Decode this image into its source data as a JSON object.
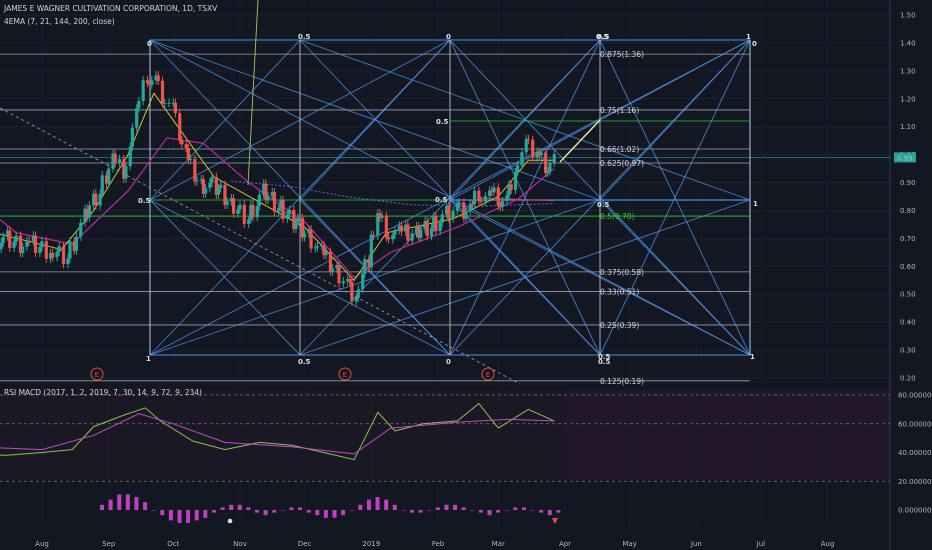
{
  "header": {
    "title": "JAMES E WAGNER CULTIVATION CORPORATION, 1D, TSXV",
    "indicator": "4EMA (7, 21, 144, 200, close)",
    "sub_indicator": "RSI MACD (2017, 1, 2, 2019, 7, 30, 14, 9, 72, 9, 234)"
  },
  "colors": {
    "background": "#131722",
    "up": "#26a69a",
    "down": "#ef5350",
    "ema_fast": "#c8c830",
    "ema_mid": "#b0299b",
    "gann": "#4a90e2",
    "fib": "#d1d4dc",
    "fib_green": "#33cc33",
    "rsi": "#8bc34a",
    "signal": "#c34ac0",
    "hist": "#c040c0"
  },
  "chart_data": [
    {
      "type": "candlestick",
      "title": "JAMES E WAGNER CULTIVATION CORPORATION, 1D, TSXV",
      "y_axis": {
        "ticks": [
          1.5,
          1.4,
          1.3,
          1.2,
          1.1,
          1.0,
          0.9,
          0.8,
          0.7,
          0.6,
          0.5,
          0.4,
          0.3,
          0.2
        ],
        "ylim": [
          0.19,
          1.54
        ],
        "side": "right"
      },
      "x_axis": {
        "ticks": [
          "Aug",
          "Sep",
          "Oct",
          "Nov",
          "Dec",
          "2019",
          "Feb",
          "Mar",
          "Apr",
          "May",
          "Jun",
          "Jul",
          "Aug"
        ]
      },
      "last_price": "0.99",
      "price_marks": [
        {
          "date": "2018-07-10",
          "price": 0.7
        },
        {
          "date": "2018-07-25",
          "price": 0.68
        },
        {
          "date": "2018-08-05",
          "price": 0.66
        },
        {
          "date": "2018-08-13",
          "price": 0.64
        },
        {
          "date": "2018-08-21",
          "price": 0.77
        },
        {
          "date": "2018-08-28",
          "price": 0.86
        },
        {
          "date": "2018-09-03",
          "price": 0.98
        },
        {
          "date": "2018-09-08",
          "price": 0.95
        },
        {
          "date": "2018-09-14",
          "price": 1.13
        },
        {
          "date": "2018-09-19",
          "price": 1.28
        },
        {
          "date": "2018-09-23",
          "price": 1.26
        },
        {
          "date": "2018-09-26",
          "price": 1.22
        },
        {
          "date": "2018-10-01",
          "price": 1.15
        },
        {
          "date": "2018-10-07",
          "price": 1.0
        },
        {
          "date": "2018-10-14",
          "price": 0.9
        },
        {
          "date": "2018-10-21",
          "price": 0.88
        },
        {
          "date": "2018-10-28",
          "price": 0.82
        },
        {
          "date": "2018-11-05",
          "price": 0.78
        },
        {
          "date": "2018-11-12",
          "price": 0.86
        },
        {
          "date": "2018-11-19",
          "price": 0.81
        },
        {
          "date": "2018-11-26",
          "price": 0.77
        },
        {
          "date": "2018-12-03",
          "price": 0.72
        },
        {
          "date": "2018-12-09",
          "price": 0.64
        },
        {
          "date": "2018-12-16",
          "price": 0.58
        },
        {
          "date": "2018-12-21",
          "price": 0.53
        },
        {
          "date": "2018-12-25",
          "price": 0.5
        },
        {
          "date": "2018-12-31",
          "price": 0.62
        },
        {
          "date": "2019-01-04",
          "price": 0.79
        },
        {
          "date": "2019-01-08",
          "price": 0.74
        },
        {
          "date": "2019-01-14",
          "price": 0.71
        },
        {
          "date": "2019-01-22",
          "price": 0.72
        },
        {
          "date": "2019-01-29",
          "price": 0.75
        },
        {
          "date": "2019-02-05",
          "price": 0.78
        },
        {
          "date": "2019-02-10",
          "price": 0.79
        },
        {
          "date": "2019-02-16",
          "price": 0.8
        },
        {
          "date": "2019-02-20",
          "price": 0.87
        },
        {
          "date": "2019-02-25",
          "price": 0.86
        },
        {
          "date": "2019-03-01",
          "price": 0.84
        },
        {
          "date": "2019-03-05",
          "price": 0.83
        },
        {
          "date": "2019-03-09",
          "price": 0.95
        },
        {
          "date": "2019-03-14",
          "price": 1.02
        },
        {
          "date": "2019-03-19",
          "price": 1.01
        },
        {
          "date": "2019-03-23",
          "price": 0.97
        },
        {
          "date": "2019-03-27",
          "price": 0.99
        }
      ],
      "ema_fast": [
        {
          "date": "2018-07-10",
          "price": 0.72
        },
        {
          "date": "2018-08-10",
          "price": 0.66
        },
        {
          "date": "2018-08-25",
          "price": 0.8
        },
        {
          "date": "2018-09-10",
          "price": 1.0
        },
        {
          "date": "2018-09-22",
          "price": 1.22
        },
        {
          "date": "2018-10-05",
          "price": 1.08
        },
        {
          "date": "2018-10-20",
          "price": 0.92
        },
        {
          "date": "2018-11-10",
          "price": 0.83
        },
        {
          "date": "2018-12-01",
          "price": 0.74
        },
        {
          "date": "2018-12-24",
          "price": 0.55
        },
        {
          "date": "2019-01-08",
          "price": 0.72
        },
        {
          "date": "2019-02-08",
          "price": 0.77
        },
        {
          "date": "2019-03-01",
          "price": 0.85
        },
        {
          "date": "2019-03-15",
          "price": 0.98
        },
        {
          "date": "2019-03-27",
          "price": 0.98
        }
      ],
      "ema_mid": [
        {
          "date": "2018-07-01",
          "price": 0.84
        },
        {
          "date": "2018-07-20",
          "price": 0.72
        },
        {
          "date": "2018-08-15",
          "price": 0.68
        },
        {
          "date": "2018-09-10",
          "price": 0.87
        },
        {
          "date": "2018-09-28",
          "price": 1.06
        },
        {
          "date": "2018-10-15",
          "price": 1.04
        },
        {
          "date": "2018-11-05",
          "price": 0.9
        },
        {
          "date": "2018-12-01",
          "price": 0.76
        },
        {
          "date": "2018-12-24",
          "price": 0.56
        },
        {
          "date": "2019-01-10",
          "price": 0.65
        },
        {
          "date": "2019-02-10",
          "price": 0.74
        },
        {
          "date": "2019-03-10",
          "price": 0.84
        },
        {
          "date": "2019-03-27",
          "price": 0.95
        }
      ],
      "ema_slow": [
        {
          "date": "2018-10-28",
          "price": 0.905
        },
        {
          "date": "2018-11-25",
          "price": 0.885
        },
        {
          "date": "2018-12-20",
          "price": 0.85
        },
        {
          "date": "2019-01-20",
          "price": 0.82
        },
        {
          "date": "2019-02-20",
          "price": 0.815
        },
        {
          "date": "2019-03-27",
          "price": 0.825
        }
      ],
      "ema_slowest": [
        {
          "date": "2019-02-20",
          "price": 0.845
        },
        {
          "date": "2019-03-27",
          "price": 0.835
        }
      ],
      "fib_levels": [
        {
          "label": "0.875(1.36)",
          "price": 1.36,
          "green": false
        },
        {
          "label": "0.75(1.16)",
          "price": 1.16,
          "green": false
        },
        {
          "label": "0.66(1.02)",
          "price": 1.02,
          "green": false
        },
        {
          "label": "0.625(0.97)",
          "price": 0.97,
          "green": false
        },
        {
          "label": "0.5(0.78)",
          "price": 0.78,
          "green": true
        },
        {
          "label": "0.375(0.58)",
          "price": 0.58,
          "green": false
        },
        {
          "label": "0.33(0.51)",
          "price": 0.51,
          "green": false
        },
        {
          "label": "0.25(0.39)",
          "price": 0.39,
          "green": false
        },
        {
          "label": "0.125(0.19)",
          "price": 0.19,
          "green": false
        }
      ],
      "gann_labels": [
        "0",
        "0.5",
        "0",
        "0.5",
        "1",
        "0",
        "1",
        "0.5",
        "0",
        "0.5",
        "1",
        "0.5",
        "0.5",
        "0.5",
        "1",
        "0.5",
        "0.5",
        "0.5"
      ],
      "events": [
        "E",
        "E",
        "E"
      ]
    },
    {
      "type": "line",
      "title": "RSI MACD (2017, 1, 2, 2019, 7, 30, 14, 9, 72, 9, 234)",
      "y_axis": {
        "ticks": [
          80,
          60,
          40,
          20,
          0
        ],
        "tick_labels": [
          "80.000000",
          "60.000000",
          "40.000000",
          "20.000000",
          "0.000000"
        ],
        "side": "right"
      },
      "series": [
        {
          "name": "",
          "points": [
            {
              "date": "2018-07-01",
              "value": 40
            },
            {
              "date": "2018-07-15",
              "value": 38
            },
            {
              "date": "2018-08-01",
              "value": 40
            },
            {
              "date": "2018-08-15",
              "value": 42
            },
            {
              "date": "2018-08-25",
              "value": 58
            },
            {
              "date": "2018-09-08",
              "value": 66
            },
            {
              "date": "2018-09-18",
              "value": 71
            },
            {
              "date": "2018-09-25",
              "value": 62
            },
            {
              "date": "2018-10-10",
              "value": 48
            },
            {
              "date": "2018-10-25",
              "value": 42
            },
            {
              "date": "2018-11-10",
              "value": 47
            },
            {
              "date": "2018-11-25",
              "value": 45
            },
            {
              "date": "2018-12-10",
              "value": 40
            },
            {
              "date": "2018-12-24",
              "value": 35
            },
            {
              "date": "2019-01-04",
              "value": 68
            },
            {
              "date": "2019-01-12",
              "value": 55
            },
            {
              "date": "2019-01-25",
              "value": 60
            },
            {
              "date": "2019-02-10",
              "value": 62
            },
            {
              "date": "2019-02-20",
              "value": 74
            },
            {
              "date": "2019-03-01",
              "value": 57
            },
            {
              "date": "2019-03-15",
              "value": 70
            },
            {
              "date": "2019-03-27",
              "value": 62
            }
          ]
        },
        {
          "name": "",
          "points": [
            {
              "date": "2018-07-01",
              "value": 44
            },
            {
              "date": "2018-08-01",
              "value": 42
            },
            {
              "date": "2018-08-25",
              "value": 52
            },
            {
              "date": "2018-09-15",
              "value": 67
            },
            {
              "date": "2018-10-01",
              "value": 60
            },
            {
              "date": "2018-10-25",
              "value": 47
            },
            {
              "date": "2018-11-25",
              "value": 44
            },
            {
              "date": "2018-12-24",
              "value": 39
            },
            {
              "date": "2019-01-10",
              "value": 57
            },
            {
              "date": "2019-02-10",
              "value": 61
            },
            {
              "date": "2019-03-05",
              "value": 63
            },
            {
              "date": "2019-03-27",
              "value": 62
            }
          ]
        }
      ],
      "histogram": [
        2,
        4,
        6,
        6,
        5,
        3,
        0,
        -2,
        -4,
        -5,
        -5,
        -4,
        -3,
        -1,
        1,
        2,
        2,
        1,
        -1,
        -2,
        -1,
        0,
        1,
        1,
        -1,
        -2,
        -3,
        -3,
        -2,
        0,
        2,
        4,
        5,
        4,
        2,
        0,
        -1,
        -1,
        0,
        1,
        2,
        2,
        1,
        0,
        -1,
        -2,
        -1,
        0,
        1,
        1,
        0,
        -1,
        -2,
        -1
      ]
    }
  ]
}
